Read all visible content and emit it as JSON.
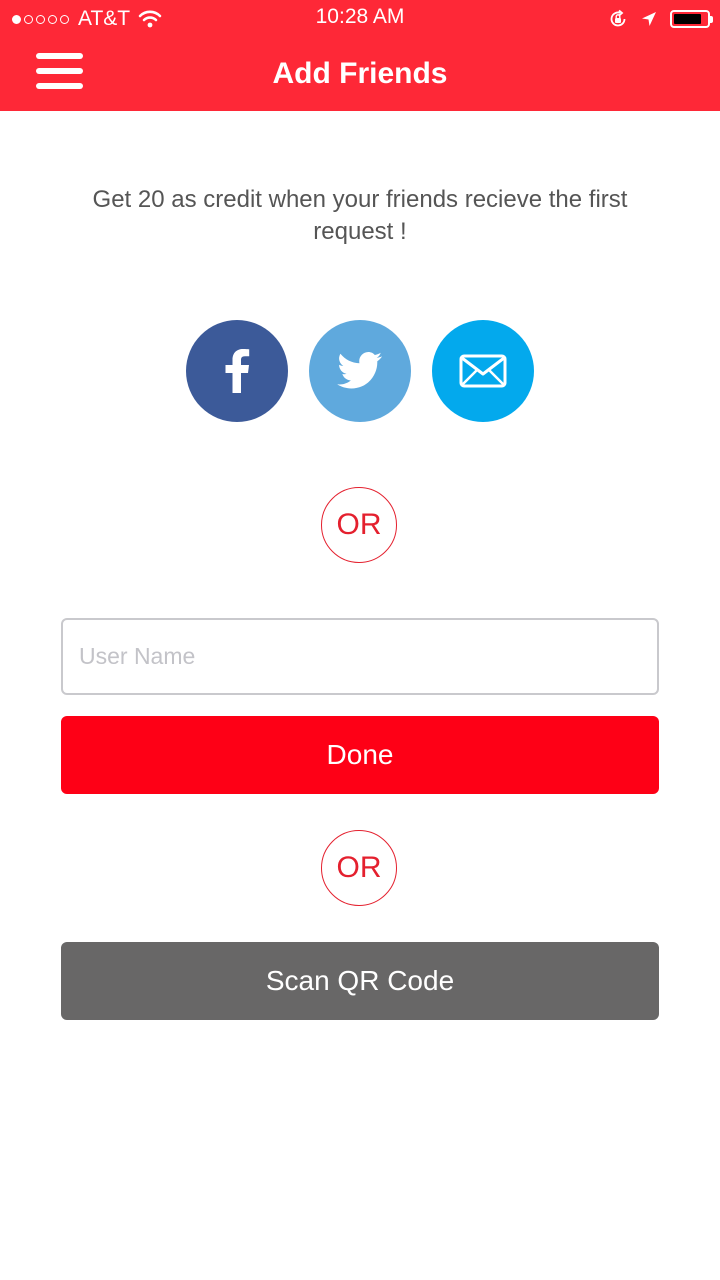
{
  "status_bar": {
    "carrier": "AT&T",
    "time": "10:28 AM",
    "signal_bars_filled": 1,
    "signal_bars_total": 5,
    "battery_level": 0.85
  },
  "header": {
    "title": "Add Friends",
    "background_color": "#fe2837",
    "menu_icon": "hamburger-menu-icon"
  },
  "info_text": "Get 20 as credit when your friends recieve the first request !",
  "social_buttons": [
    {
      "name": "facebook",
      "icon": "facebook-icon",
      "color": "#3c5a99"
    },
    {
      "name": "twitter",
      "icon": "twitter-icon",
      "color": "#5fa9dd"
    },
    {
      "name": "email",
      "icon": "mail-icon",
      "color": "#03a9ed"
    }
  ],
  "separator_label": "OR",
  "username_input": {
    "placeholder": "User Name",
    "value": ""
  },
  "done_button": {
    "label": "Done",
    "color": "#fe0016"
  },
  "scan_button": {
    "label": "Scan QR Code",
    "color": "#686767"
  }
}
